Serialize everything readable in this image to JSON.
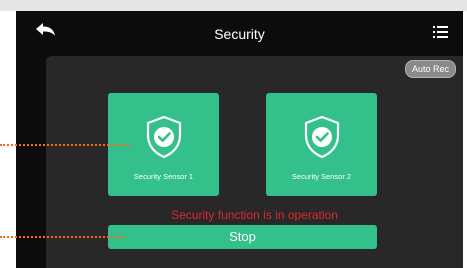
{
  "header": {
    "title": "Security",
    "back_icon": "back-arrow-icon",
    "menu_icon": "list-menu-icon"
  },
  "panel": {
    "auto_rec_label": "Auto Rec",
    "sensors": [
      {
        "label": "Security Sensor 1",
        "icon": "shield-check-icon"
      },
      {
        "label": "Security Sensor 2",
        "icon": "shield-check-icon"
      }
    ],
    "status_text": "Security function is in operation",
    "stop_label": "Stop"
  },
  "colors": {
    "accent_green": "#34c08a",
    "status_red": "#e0262a",
    "annotation_orange": "#ff6a1a",
    "screen_bg": "#0c0c0c",
    "panel_bg": "#282828"
  }
}
